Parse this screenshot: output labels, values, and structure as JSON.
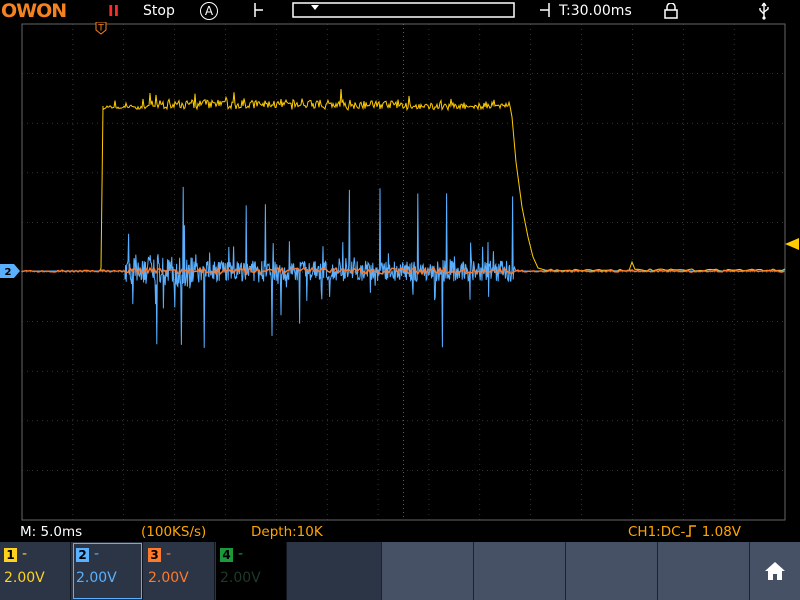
{
  "header": {
    "brand": "OWON",
    "run_state_icon": "II",
    "run_state": "Stop",
    "acquire_mode": "A",
    "trigger_time": "T:30.00ms",
    "icons": [
      "pause-icon",
      "acquire-mode-icon",
      "lock-icon",
      "usb-icon"
    ]
  },
  "status": {
    "timebase": "M: 5.0ms",
    "sample_rate": "(100KS/s)",
    "depth": "Depth:10K",
    "trigger": "CH1:DC-",
    "trigger_level": "1.08V"
  },
  "channels": [
    {
      "num": "1",
      "coupling": "-",
      "volts": "2.00V",
      "color": "#ffd21f",
      "active": true
    },
    {
      "num": "2",
      "coupling": "-",
      "volts": "2.00V",
      "color": "#59b1ff",
      "active": true
    },
    {
      "num": "3",
      "coupling": "-",
      "volts": "2.00V",
      "color": "#ff7a2a",
      "active": true
    },
    {
      "num": "4",
      "coupling": "-",
      "volts": "2.00V",
      "color": "#1a9a3a",
      "active": false
    }
  ],
  "markers": {
    "trigger_marker": "T",
    "ch2_marker": "2"
  },
  "colors": {
    "ch1": "#ffcc00",
    "ch2": "#5ab0ff",
    "ch3": "#ff7a2a",
    "grid": "#555555",
    "panel": "#2b3545"
  },
  "home_icon": "home-icon"
}
